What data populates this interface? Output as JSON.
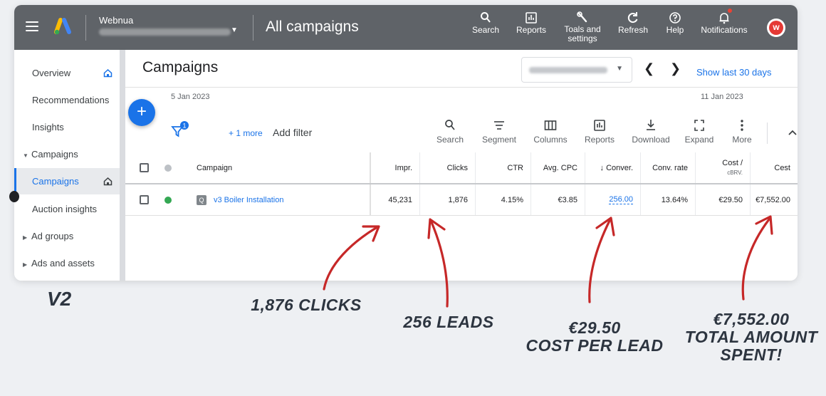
{
  "topbar": {
    "account_name": "Webnua",
    "page_title": "All campaigns",
    "tools": [
      {
        "label": "Search",
        "icon": "search-icon"
      },
      {
        "label": "Reports",
        "icon": "reports-icon"
      },
      {
        "label": "Toals and settings",
        "icon": "wrench-icon"
      },
      {
        "label": "Refresh",
        "icon": "refresh-icon"
      },
      {
        "label": "Help",
        "icon": "help-icon"
      },
      {
        "label": "Notifications",
        "icon": "bell-icon"
      }
    ],
    "avatar_letter": "w"
  },
  "sidebar": {
    "items": [
      {
        "label": "Overview"
      },
      {
        "label": "Recommendations"
      },
      {
        "label": "Insights"
      },
      {
        "label": "Campaigns"
      },
      {
        "label": "Campaigns"
      },
      {
        "label": "Auction insights"
      },
      {
        "label": "Ad groups"
      },
      {
        "label": "Ads and assets"
      }
    ]
  },
  "main": {
    "title": "Campaigns",
    "show_last": "Show last 30 days",
    "date_start": "5 Jan 2023",
    "date_end": "11 Jan 2023",
    "more_filters": "+ 1 more",
    "add_filter": "Add filter",
    "filter_badge": "1",
    "toolbar": [
      {
        "label": "Search",
        "icon": "search-icon"
      },
      {
        "label": "Segment",
        "icon": "segment-icon"
      },
      {
        "label": "Columns",
        "icon": "columns-icon"
      },
      {
        "label": "Reports",
        "icon": "reports-icon"
      },
      {
        "label": "Download",
        "icon": "download-icon"
      },
      {
        "label": "Expand",
        "icon": "expand-icon"
      },
      {
        "label": "More",
        "icon": "more-icon"
      }
    ]
  },
  "table": {
    "headers": {
      "campaign": "Campaign",
      "impr": "Impr.",
      "clicks": "Clicks",
      "ctr": "CTR",
      "avg_cpc": "Avg. CPC",
      "conv": "↓ Conver.",
      "conv_rate": "Conv. rate",
      "cost_conv_1": "Cost /",
      "cost_conv_2": "cBRV.",
      "cost": "Cest"
    },
    "row": {
      "campaign": "v3 Boiler Installation",
      "impr": "45,231",
      "clicks": "1,876",
      "ctr": "4.15%",
      "avg_cpc": "€3.85",
      "conv": "256.00",
      "conv_rate": "13.64%",
      "cost_conv": "€29.50",
      "cost": "€7,552.00",
      "status_color": "#34a853"
    }
  },
  "annotations": {
    "version": "V2",
    "clicks": "1,876 CLICKS",
    "leads": "256 LEADS",
    "cpl_1": "€29.50",
    "cpl_2": "COST PER LEAD",
    "total_1": "€7,552.00",
    "total_2": "TOTAL AMOUNT",
    "total_3": "SPENT!"
  },
  "colors": {
    "topbar": "#5f6368",
    "link": "#1a73e8",
    "arrow": "#c62828",
    "annotation": "#2d3540"
  }
}
